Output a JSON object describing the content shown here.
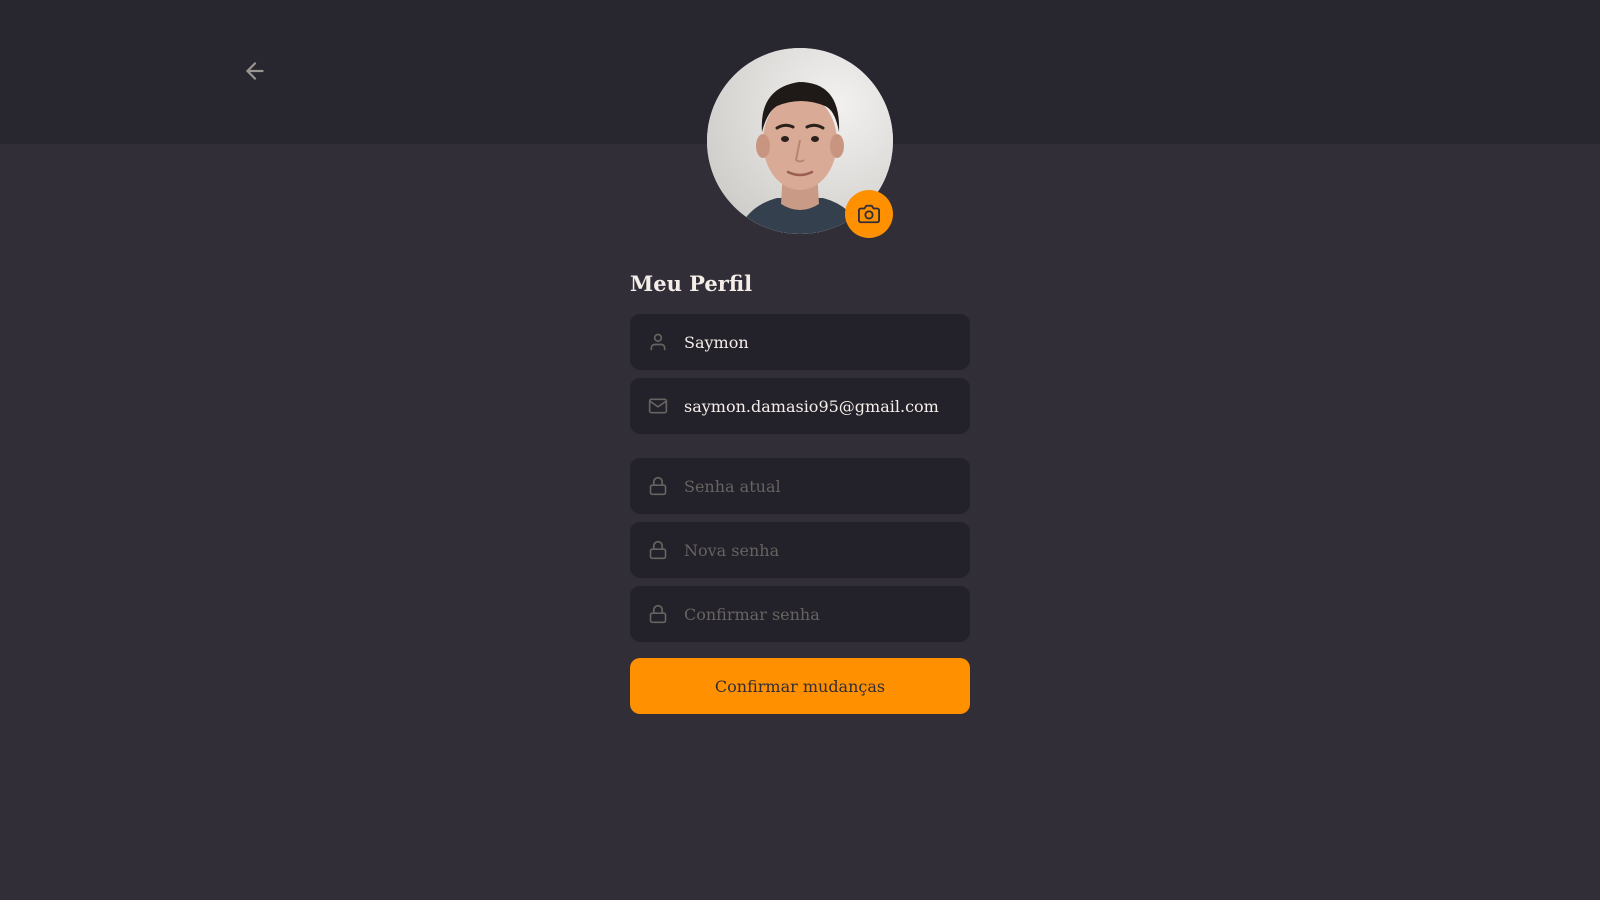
{
  "header": {
    "back_icon": "arrow-left-icon"
  },
  "profile": {
    "avatar_alt": "avatar-photo",
    "camera_icon": "camera-icon"
  },
  "form": {
    "title": "Meu Perfil",
    "name": {
      "value": "Saymon",
      "icon": "user-icon"
    },
    "email": {
      "value": "saymon.damasio95@gmail.com",
      "icon": "mail-icon"
    },
    "current_password": {
      "placeholder": "Senha atual",
      "icon": "lock-icon"
    },
    "new_password": {
      "placeholder": "Nova senha",
      "icon": "lock-icon"
    },
    "confirm_password": {
      "placeholder": "Confirmar senha",
      "icon": "lock-icon"
    },
    "submit_label": "Confirmar mudanças"
  },
  "colors": {
    "background": "#312e38",
    "header": "#28262e",
    "input_bg": "#232129",
    "accent": "#ff9000",
    "text": "#f4ede8",
    "placeholder": "#666360"
  }
}
